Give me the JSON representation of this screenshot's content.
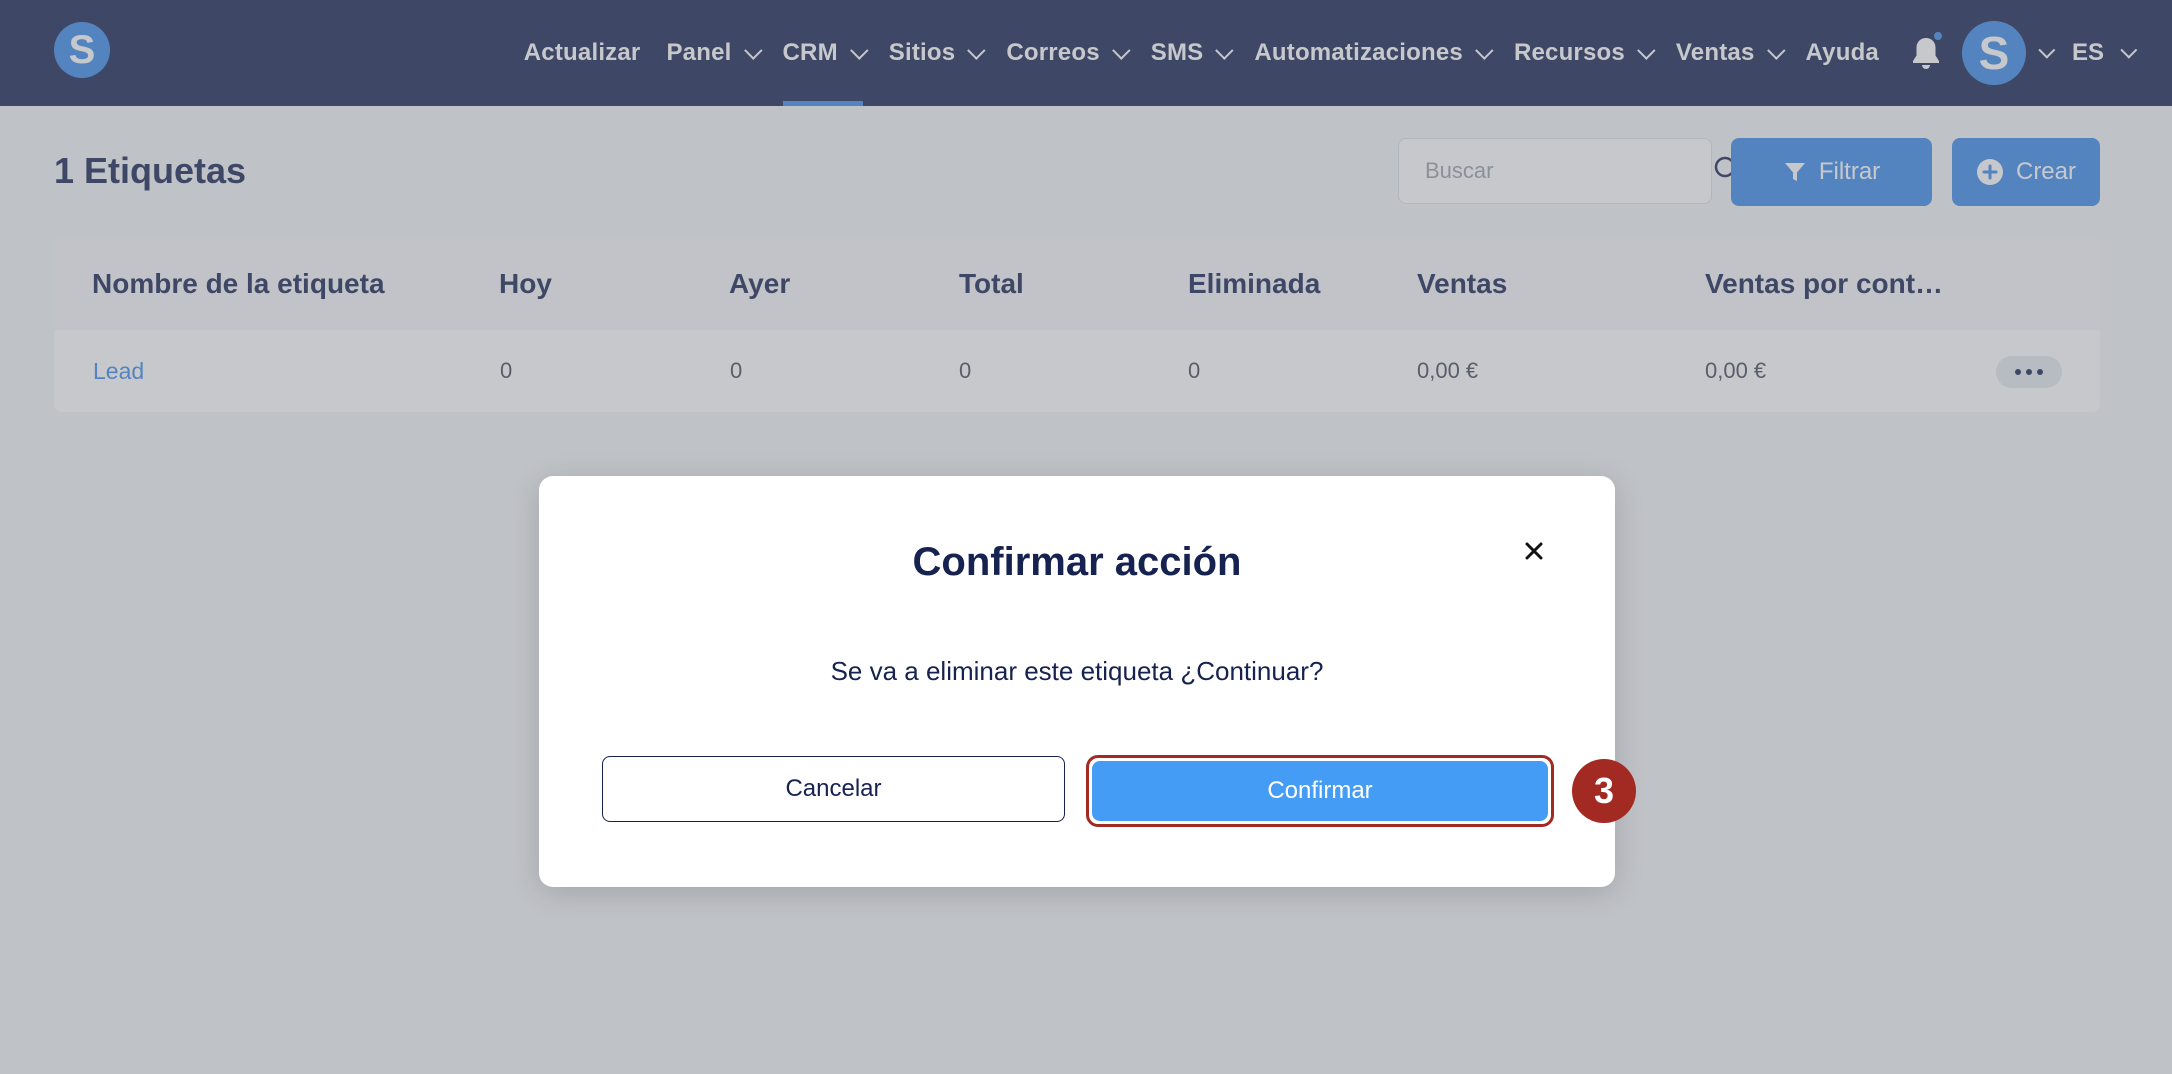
{
  "brand": {
    "logo_letter": "S",
    "accent_color": "#3b8beb",
    "nav_bg": "#16224f"
  },
  "nav": {
    "items": [
      {
        "label": "Actualizar",
        "dropdown": false
      },
      {
        "label": "Panel",
        "dropdown": true
      },
      {
        "label": "CRM",
        "dropdown": true,
        "active": true
      },
      {
        "label": "Sitios",
        "dropdown": true
      },
      {
        "label": "Correos",
        "dropdown": true
      },
      {
        "label": "SMS",
        "dropdown": true
      },
      {
        "label": "Automatizaciones",
        "dropdown": true
      },
      {
        "label": "Recursos",
        "dropdown": true
      },
      {
        "label": "Ventas",
        "dropdown": true
      },
      {
        "label": "Ayuda",
        "dropdown": false
      }
    ],
    "notifications_icon": "bell-icon",
    "avatar_letter": "S",
    "language": "ES"
  },
  "page": {
    "title": "1 Etiquetas",
    "search_placeholder": "Buscar",
    "filter_label": "Filtrar",
    "create_label": "Crear"
  },
  "table": {
    "headers": [
      "Nombre de la etiqueta",
      "Hoy",
      "Ayer",
      "Total",
      "Eliminada",
      "Ventas",
      "Ventas por cont…"
    ],
    "rows": [
      {
        "name": "Lead",
        "hoy": "0",
        "ayer": "0",
        "total": "0",
        "eliminada": "0",
        "ventas": "0,00 €",
        "ventas_por_contacto": "0,00 €"
      }
    ]
  },
  "modal": {
    "title": "Confirmar acción",
    "message": "Se va a eliminar este etiqueta ¿Continuar?",
    "cancel_label": "Cancelar",
    "confirm_label": "Confirmar"
  },
  "annotation": {
    "step": "3",
    "color": "#a32a22"
  }
}
